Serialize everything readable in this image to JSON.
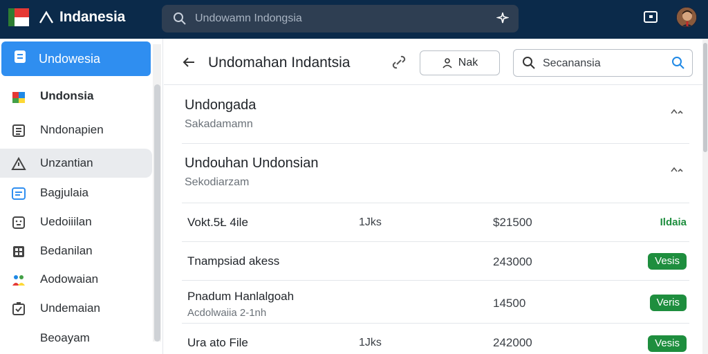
{
  "topbar": {
    "brand_title": "Indanesia",
    "search_text": "Undowamn Indongsia",
    "icons": [
      "flag-icon",
      "brand-logo-icon",
      "search-icon",
      "settings-spark-icon",
      "external-window-icon"
    ]
  },
  "sidebar": {
    "items": [
      {
        "label": "Undowesia",
        "icon": "document-icon"
      },
      {
        "label": "Undonsia",
        "icon": "colorful-app-icon"
      },
      {
        "label": "Nndonapien",
        "icon": "list-icon"
      },
      {
        "label": "Unzantian",
        "icon": "warning-icon"
      },
      {
        "label": "Bagjulaia",
        "icon": "message-icon"
      },
      {
        "label": "Uedoiiilan",
        "icon": "face-icon"
      },
      {
        "label": "Bedanilan",
        "icon": "grid-icon"
      },
      {
        "label": "Aodowaian",
        "icon": "people-icon"
      },
      {
        "label": "Undemaian",
        "icon": "checklist-icon"
      },
      {
        "label": "Beoayam",
        "icon": ""
      }
    ]
  },
  "main": {
    "title": "Undomahan Indantsia",
    "button_label": "Nak",
    "search_placeholder": "Secanansia",
    "sections": [
      {
        "title": "Undongada",
        "subtitle": "Sakadamamn"
      },
      {
        "title": "Undouhan Undonsian",
        "subtitle": "Sekodiarzam"
      }
    ],
    "rows": [
      {
        "name": "Vokt.5Ł 4ile",
        "subtitle": "",
        "size": "1Jks",
        "amount": "$21500",
        "badge": "Ildaia",
        "badge_style": "text"
      },
      {
        "name": "Tnampsiad akess",
        "subtitle": "",
        "size": "",
        "amount": "243000",
        "badge": "Vesis",
        "badge_style": "pill"
      },
      {
        "name": "Pnadum Hanlalgoah",
        "subtitle": "Acdolwaiia 2-1nh",
        "size": "",
        "amount": "14500",
        "badge": "Veris",
        "badge_style": "pill"
      },
      {
        "name": "Ura ato File",
        "subtitle": "",
        "size": "1Jks",
        "amount": "242000",
        "badge": "Vesis",
        "badge_style": "pill"
      }
    ]
  },
  "colors": {
    "topbar_bg": "#0b2a4a",
    "accent": "#2f8ef0",
    "badge_green": "#1e8e3e"
  }
}
